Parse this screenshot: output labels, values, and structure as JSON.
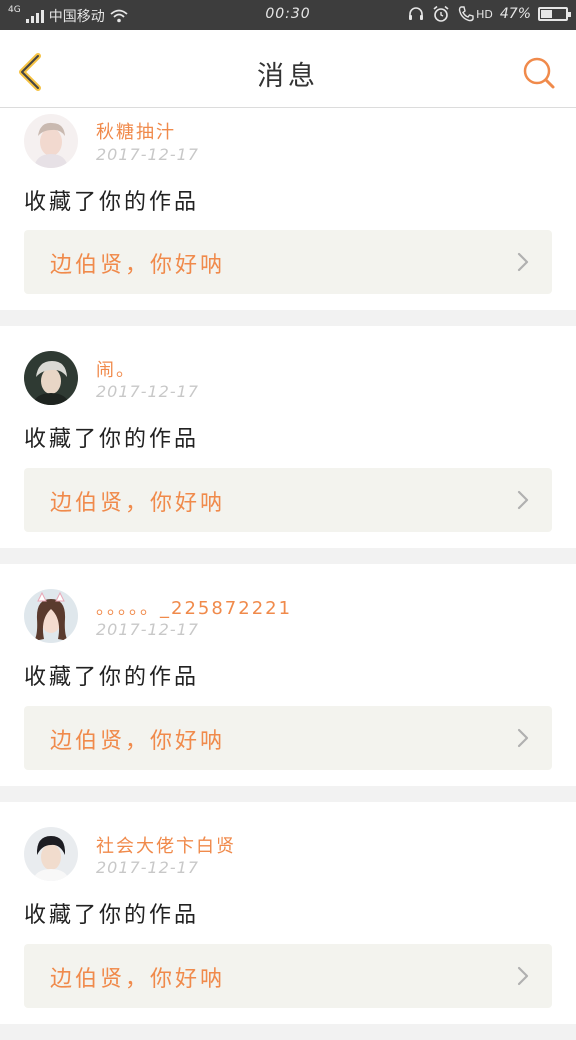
{
  "status_bar": {
    "network": "4G",
    "carrier": "中国移动",
    "time": "00:30",
    "hd_label": "HD",
    "battery_percent": "47%",
    "battery_level": 0.47,
    "icons": [
      "signal-icon",
      "wifi-icon",
      "headset-icon",
      "alarm-icon",
      "call-icon",
      "battery-icon"
    ]
  },
  "header": {
    "title": "消息",
    "back_icon": "chevron-left-icon",
    "search_icon": "search-icon"
  },
  "colors": {
    "accent": "#f08a4b",
    "back_icon": "#f5c242",
    "date": "#c8c8c8",
    "reply_bg": "#f3f3ee",
    "statusbar_bg": "#3d3d3d"
  },
  "messages": [
    {
      "username": "秋糖抽汁",
      "date": "2017-12-17",
      "action": "收藏了你的作品",
      "reply": "边伯贤，你好呐"
    },
    {
      "username": "闹。",
      "date": "2017-12-17",
      "action": "收藏了你的作品",
      "reply": "边伯贤，你好呐"
    },
    {
      "username": "。。。。。_225872221",
      "date": "2017-12-17",
      "action": "收藏了你的作品",
      "reply": "边伯贤，你好呐"
    },
    {
      "username": "社会大佬卞白贤",
      "date": "2017-12-17",
      "action": "收藏了你的作品",
      "reply": "边伯贤，你好呐"
    }
  ]
}
